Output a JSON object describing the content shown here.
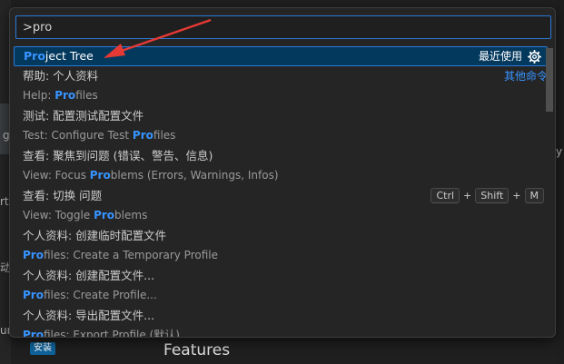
{
  "background": {
    "left_fragments": [
      "g",
      "rt",
      "动",
      "ur"
    ],
    "right_fragment": "y",
    "badge": "安装",
    "features_heading": "Features"
  },
  "quick_pick": {
    "input_value": ">pro",
    "items": [
      {
        "title_prefix": "Pro",
        "title_rest": "ject Tree",
        "recent_label": "最近使用"
      },
      {
        "title": "帮助: 个人资料",
        "sub_prefix": "Help: ",
        "sub_hl": "Pro",
        "sub_rest": "files",
        "right": "其他命令"
      },
      {
        "title": "测试: 配置测试配置文件",
        "sub_prefix": "Test: Configure Test ",
        "sub_hl": "Pro",
        "sub_rest": "files"
      },
      {
        "title": "查看: 聚焦到问题 (错误、警告、信息)",
        "sub_prefix": "View: Focus ",
        "sub_hl": "Pro",
        "sub_rest": "blems (Errors, Warnings, Infos)"
      },
      {
        "title": "查看: 切换 问题",
        "sub_prefix": "View: Toggle ",
        "sub_hl": "Pro",
        "sub_rest": "blems",
        "keys": [
          "Ctrl",
          "Shift",
          "M"
        ],
        "key_sep": "+"
      },
      {
        "title": "个人资料: 创建临时配置文件",
        "sub_prefix": "",
        "sub_hl": "Pro",
        "sub_rest": "files: Create a Temporary Profile"
      },
      {
        "title": "个人资料: 创建配置文件...",
        "sub_prefix": "",
        "sub_hl": "Pro",
        "sub_rest": "files: Create Profile..."
      },
      {
        "title": "个人资料: 导出配置文件...",
        "sub_prefix": "",
        "sub_hl": "Pro",
        "sub_rest": "files: Export Profile (默认)"
      }
    ]
  },
  "colors": {
    "accent": "#2b79d6",
    "highlight": "#3794ff",
    "selection": "#04395e",
    "annotation_arrow": "#e53935"
  }
}
